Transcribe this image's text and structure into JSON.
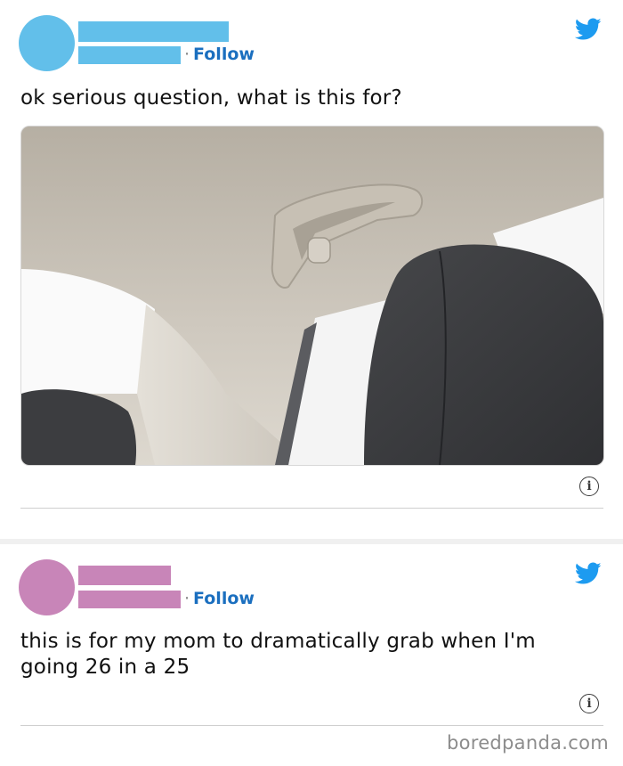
{
  "colors": {
    "tweet1_avatar": "#62bfea",
    "tweet1_redaction": "#62bfea",
    "tweet2_avatar": "#c885b8",
    "tweet2_redaction": "#c885b8",
    "link_blue": "#1b6fbf",
    "twitter_blue": "#1d9bf0"
  },
  "tweets": [
    {
      "follow_separator": "·",
      "follow_label": "Follow",
      "text": "ok serious question, what is this for?",
      "image": {
        "icon": "photo-car-interior-grab-handle"
      },
      "info_symbol": "i",
      "bird_icon": "twitter-bird-icon"
    },
    {
      "follow_separator": "·",
      "follow_label": "Follow",
      "text": "this is for my mom to dramatically grab when I'm going 26 in a 25",
      "info_symbol": "i",
      "bird_icon": "twitter-bird-icon"
    }
  ],
  "watermark": "boredpanda.com"
}
